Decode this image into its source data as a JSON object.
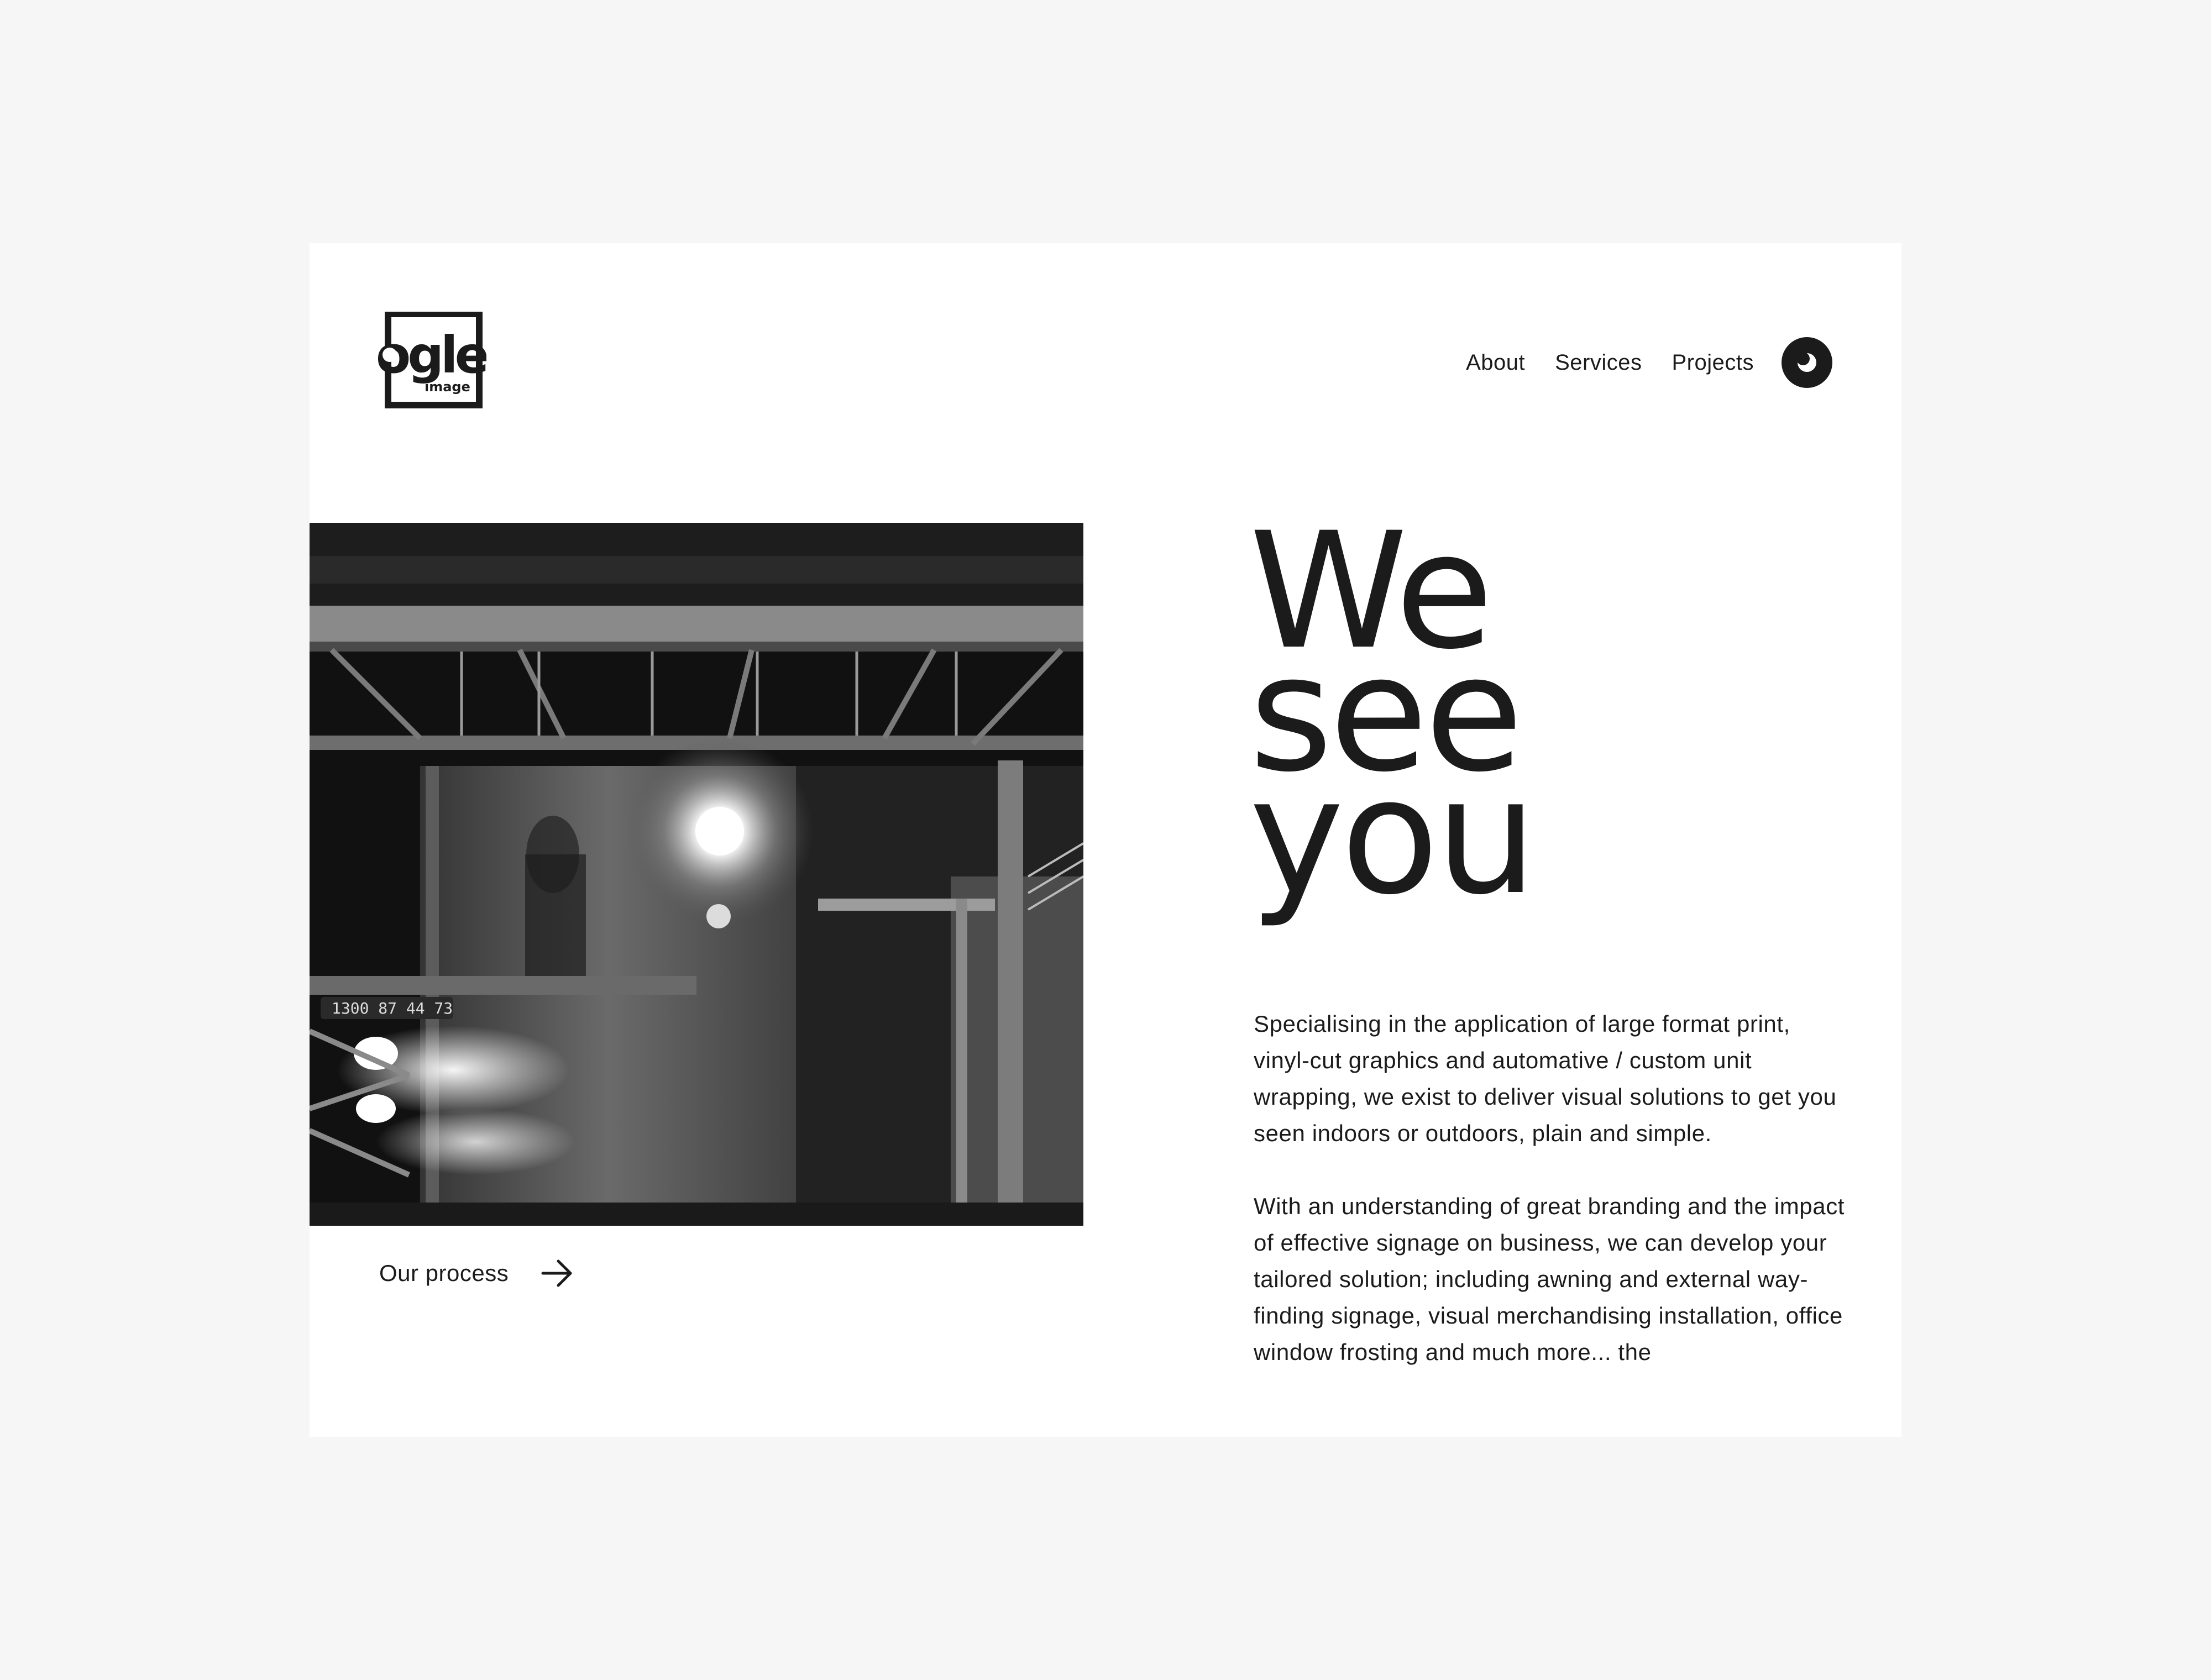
{
  "brand": {
    "logo_text": "ogle",
    "logo_subtext": "image"
  },
  "nav": {
    "items": [
      {
        "label": "About"
      },
      {
        "label": "Services"
      },
      {
        "label": "Projects"
      }
    ],
    "theme_toggle_icon": "eye-icon"
  },
  "hero": {
    "image_icon": "warehouse-photo",
    "image_sign_text": "1300 87 44 73",
    "process_link": {
      "label": "Our process",
      "icon": "arrow-right-icon"
    },
    "headline": [
      "We",
      "see",
      "you"
    ],
    "paragraphs": [
      "Specialising in the application of large format print, vinyl-cut graphics and automative / custom unit wrapping, we exist to deliver visual solutions to get you seen indoors or outdoors, plain and simple.",
      "With an understanding of great branding and the impact of effective signage on business, we can develop your tailored solution; including awning and external way-finding signage, visual merchandising installation, office window frosting and much more... the"
    ]
  },
  "colors": {
    "background": "#f6f6f6",
    "card": "#ffffff",
    "ink": "#1b1b1b"
  }
}
